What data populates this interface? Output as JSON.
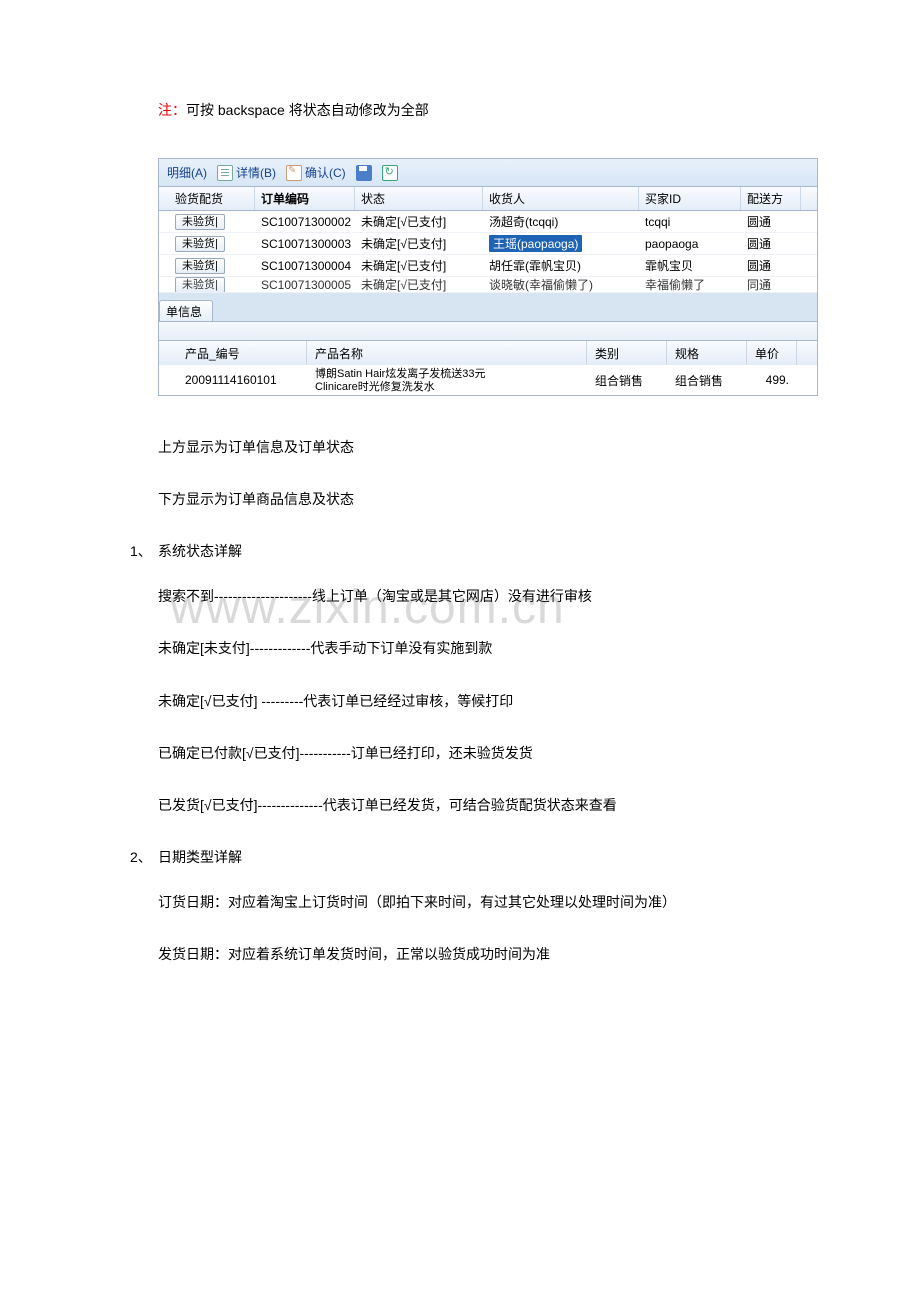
{
  "note": {
    "prefix": "注：",
    "text": "可按 backspace 将状态自动修改为全部"
  },
  "toolbar": {
    "mingxi": "明细(A)",
    "detail": "详情(B)",
    "confirm": "确认(C)"
  },
  "orders": {
    "headers": {
      "inspect": "验货配货",
      "order_no": "订单编码",
      "status": "状态",
      "receiver": "收货人",
      "buyer_id": "买家ID",
      "ship": "配送方"
    },
    "rows": [
      {
        "inspect": "未验货|",
        "order_no": "SC10071300002",
        "status": "未确定[√已支付]",
        "receiver": "汤超奇(tcqqi)",
        "buyer_id": "tcqqi",
        "ship": "圆通",
        "hl": false
      },
      {
        "inspect": "未验货|",
        "order_no": "SC10071300003",
        "status": "未确定[√已支付]",
        "receiver": "王瑶(paopaoga)",
        "buyer_id": "paopaoga",
        "ship": "圆通",
        "hl": true
      },
      {
        "inspect": "未验货|",
        "order_no": "SC10071300004",
        "status": "未确定[√已支付]",
        "receiver": "胡任霏(霏帆宝贝)",
        "buyer_id": "霏帆宝贝",
        "ship": "圆通",
        "hl": false
      },
      {
        "inspect": "未验货|",
        "order_no": "SC10071300005",
        "status": "未确定[√已支付]",
        "receiver": "谈晓敏(幸福偷懒了)",
        "buyer_id": "幸福偷懒了",
        "ship": "同通",
        "hl": false
      }
    ]
  },
  "product_tab": "单信息",
  "products": {
    "headers": {
      "num": "产品_编号",
      "name": "产品名称",
      "cat": "类别",
      "spec": "规格",
      "price": "单价"
    },
    "row": {
      "num": "20091114160101",
      "name_l1": "博朗Satin Hair炫发离子发梳送33元",
      "name_l2": "Clinicare时光修复洗发水",
      "cat": "组合销售",
      "spec": "组合销售",
      "price": "499."
    }
  },
  "paragraphs": {
    "p1": "上方显示为订单信息及订单状态",
    "p2": "下方显示为订单商品信息及状态"
  },
  "section1": {
    "num": "1、",
    "title": "系统状态详解",
    "items": [
      "搜索不到---------------------线上订单（淘宝或是其它网店）没有进行审核",
      "未确定[未支付]-------------代表手动下订单没有实施到款",
      "未确定[√已支付] ---------代表订单已经经过审核，等候打印",
      "已确定已付款[√已支付]-----------订单已经打印，还未验货发货",
      "已发货[√已支付]--------------代表订单已经发货，可结合验货配货状态来查看"
    ]
  },
  "section2": {
    "num": "2、",
    "title": "日期类型详解",
    "items": [
      "订货日期：对应着淘宝上订货时间（即拍下来时间，有过其它处理以处理时间为准）",
      "发货日期：对应着系统订单发货时间，正常以验货成功时间为准"
    ]
  },
  "watermark": "www.zixin.com.cn"
}
